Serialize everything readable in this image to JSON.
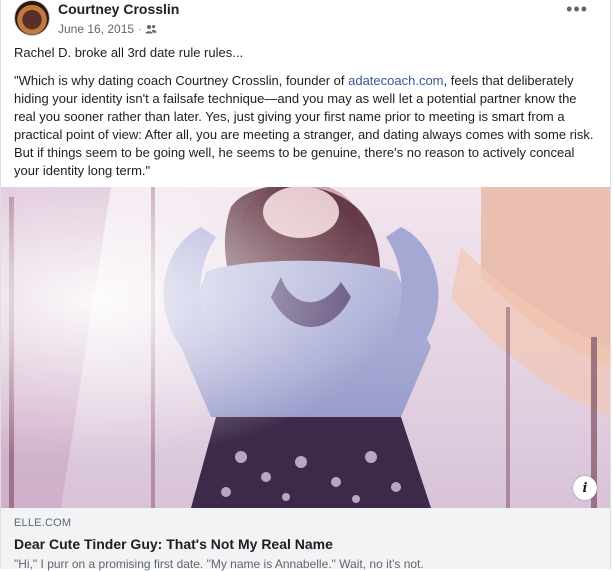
{
  "post": {
    "author": "Courtney Crosslin",
    "date": "June 16, 2015",
    "separator": "·",
    "audience_icon": "friends-icon",
    "more_label": "•••",
    "line1": "Rachel D. broke all 3rd date rule rules...",
    "quote_before_link": "\"Which is why dating coach Courtney Crosslin, founder of ",
    "quote_link": "adatecoach.com",
    "quote_after_link": ", feels that deliberately hiding your identity isn't a failsafe technique—and you may as well let a potential partner know the real you sooner rather than later. Yes, just giving your first name prior to meeting is smart from a practical point of view: After all, you are meeting a stranger, and dating always comes with some risk. But if things seem to be going well, he seems to be genuine, there's no reason to actively conceal your identity long term.\""
  },
  "link_preview": {
    "domain": "ELLE.COM",
    "title": "Dear Cute Tinder Guy: That's Not My Real Name",
    "description": "\"Hi,\" I purr on a promising first date. \"My name is Annabelle.\" Wait, no it's not.",
    "info_label": "i"
  },
  "colors": {
    "link": "#385898",
    "secondary_text": "#606770",
    "preview_bg": "#f2f3f5"
  }
}
